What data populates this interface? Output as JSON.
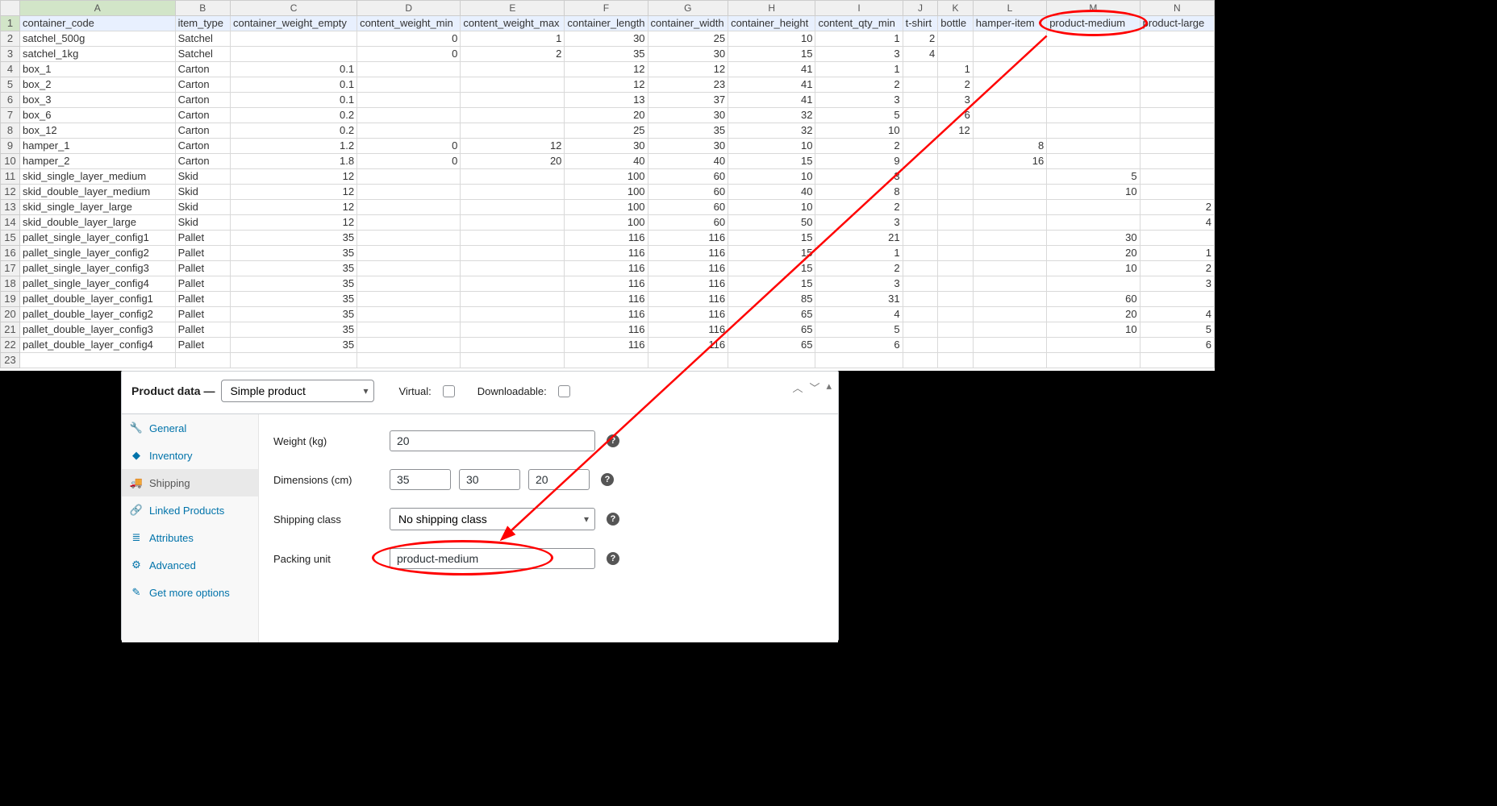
{
  "spreadsheet": {
    "column_letters": [
      "A",
      "B",
      "C",
      "D",
      "E",
      "F",
      "G",
      "H",
      "I",
      "J",
      "K",
      "L",
      "M",
      "N"
    ],
    "selected_column_index": 0,
    "selected_row_index": 0,
    "row_numbers": [
      1,
      2,
      3,
      4,
      5,
      6,
      7,
      8,
      9,
      10,
      11,
      12,
      13,
      14,
      15,
      16,
      17,
      18,
      19,
      20,
      21,
      22,
      23
    ],
    "headers": [
      "container_code",
      "item_type",
      "container_weight_empty",
      "content_weight_min",
      "content_weight_max",
      "container_length",
      "container_width",
      "container_height",
      "content_qty_min",
      "t-shirt",
      "bottle",
      "hamper-item",
      "product-medium",
      "product-large"
    ],
    "rows": [
      [
        "satchel_500g",
        "Satchel",
        "",
        "0",
        "1",
        "30",
        "25",
        "10",
        "1",
        "2",
        "",
        "",
        "",
        ""
      ],
      [
        "satchel_1kg",
        "Satchel",
        "",
        "0",
        "2",
        "35",
        "30",
        "15",
        "3",
        "4",
        "",
        "",
        "",
        ""
      ],
      [
        "box_1",
        "Carton",
        "0.1",
        "",
        "",
        "12",
        "12",
        "41",
        "1",
        "",
        "1",
        "",
        "",
        ""
      ],
      [
        "box_2",
        "Carton",
        "0.1",
        "",
        "",
        "12",
        "23",
        "41",
        "2",
        "",
        "2",
        "",
        "",
        ""
      ],
      [
        "box_3",
        "Carton",
        "0.1",
        "",
        "",
        "13",
        "37",
        "41",
        "3",
        "",
        "3",
        "",
        "",
        ""
      ],
      [
        "box_6",
        "Carton",
        "0.2",
        "",
        "",
        "20",
        "30",
        "32",
        "5",
        "",
        "6",
        "",
        "",
        ""
      ],
      [
        "box_12",
        "Carton",
        "0.2",
        "",
        "",
        "25",
        "35",
        "32",
        "10",
        "",
        "12",
        "",
        "",
        ""
      ],
      [
        "hamper_1",
        "Carton",
        "1.2",
        "0",
        "12",
        "30",
        "30",
        "10",
        "2",
        "",
        "",
        "8",
        "",
        ""
      ],
      [
        "hamper_2",
        "Carton",
        "1.8",
        "0",
        "20",
        "40",
        "40",
        "15",
        "9",
        "",
        "",
        "16",
        "",
        ""
      ],
      [
        "skid_single_layer_medium",
        "Skid",
        "12",
        "",
        "",
        "100",
        "60",
        "10",
        "3",
        "",
        "",
        "",
        "5",
        ""
      ],
      [
        "skid_double_layer_medium",
        "Skid",
        "12",
        "",
        "",
        "100",
        "60",
        "40",
        "8",
        "",
        "",
        "",
        "10",
        ""
      ],
      [
        "skid_single_layer_large",
        "Skid",
        "12",
        "",
        "",
        "100",
        "60",
        "10",
        "2",
        "",
        "",
        "",
        "",
        "2"
      ],
      [
        "skid_double_layer_large",
        "Skid",
        "12",
        "",
        "",
        "100",
        "60",
        "50",
        "3",
        "",
        "",
        "",
        "",
        "4"
      ],
      [
        "pallet_single_layer_config1",
        "Pallet",
        "35",
        "",
        "",
        "116",
        "116",
        "15",
        "21",
        "",
        "",
        "",
        "30",
        ""
      ],
      [
        "pallet_single_layer_config2",
        "Pallet",
        "35",
        "",
        "",
        "116",
        "116",
        "15",
        "1",
        "",
        "",
        "",
        "20",
        "1"
      ],
      [
        "pallet_single_layer_config3",
        "Pallet",
        "35",
        "",
        "",
        "116",
        "116",
        "15",
        "2",
        "",
        "",
        "",
        "10",
        "2"
      ],
      [
        "pallet_single_layer_config4",
        "Pallet",
        "35",
        "",
        "",
        "116",
        "116",
        "15",
        "3",
        "",
        "",
        "",
        "",
        "3"
      ],
      [
        "pallet_double_layer_config1",
        "Pallet",
        "35",
        "",
        "",
        "116",
        "116",
        "85",
        "31",
        "",
        "",
        "",
        "60",
        ""
      ],
      [
        "pallet_double_layer_config2",
        "Pallet",
        "35",
        "",
        "",
        "116",
        "116",
        "65",
        "4",
        "",
        "",
        "",
        "20",
        "4"
      ],
      [
        "pallet_double_layer_config3",
        "Pallet",
        "35",
        "",
        "",
        "116",
        "116",
        "65",
        "5",
        "",
        "",
        "",
        "10",
        "5"
      ],
      [
        "pallet_double_layer_config4",
        "Pallet",
        "35",
        "",
        "",
        "116",
        "116",
        "65",
        "6",
        "",
        "",
        "",
        "",
        "6"
      ]
    ],
    "numeric_col_from": 2
  },
  "product_panel": {
    "title_prefix": "Product data —",
    "product_type_options": [
      "Simple product"
    ],
    "product_type_selected": "Simple product",
    "virtual_label": "Virtual:",
    "virtual_checked": false,
    "downloadable_label": "Downloadable:",
    "downloadable_checked": false,
    "sidebar": [
      {
        "key": "general",
        "label": "General",
        "icon": "wrench"
      },
      {
        "key": "inventory",
        "label": "Inventory",
        "icon": "tag"
      },
      {
        "key": "shipping",
        "label": "Shipping",
        "icon": "truck",
        "active": true
      },
      {
        "key": "linked",
        "label": "Linked Products",
        "icon": "link"
      },
      {
        "key": "attrs",
        "label": "Attributes",
        "icon": "list"
      },
      {
        "key": "advanced",
        "label": "Advanced",
        "icon": "gear"
      },
      {
        "key": "more",
        "label": "Get more options",
        "icon": "pencil"
      }
    ],
    "fields": {
      "weight_label": "Weight (kg)",
      "weight_value": "20",
      "dimensions_label": "Dimensions (cm)",
      "dim_length": "35",
      "dim_width": "30",
      "dim_height": "20",
      "shipping_class_label": "Shipping class",
      "shipping_class_selected": "No shipping class",
      "packing_unit_label": "Packing unit",
      "packing_unit_value": "product-medium"
    }
  },
  "annotations": {
    "ellipse_header": {
      "note": "around column M header 'product-medium'"
    },
    "ellipse_field": {
      "note": "around Packing unit input 'product-medium'"
    },
    "arrow": {
      "note": "from header ellipse to input ellipse"
    }
  },
  "icon_glyphs": {
    "wrench": "🔧",
    "tag": "◆",
    "truck": "🚚",
    "link": "🔗",
    "list": "≣",
    "gear": "⚙",
    "pencil": "✎",
    "help": "?"
  }
}
